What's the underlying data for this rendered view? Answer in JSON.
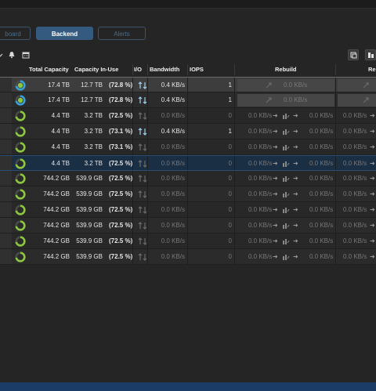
{
  "tabs": [
    {
      "label": "board"
    },
    {
      "label": "Backend"
    },
    {
      "label": "Alerts"
    }
  ],
  "columns": {
    "total_capacity": "Total Capacity",
    "capacity_in_use": "Capacity In-Use",
    "io": "I/O",
    "bandwidth": "Bandwidth",
    "iops": "IOPS",
    "rebuild": "Rebuild",
    "re": "Re"
  },
  "rows": [
    {
      "total": "17.4 TB",
      "inuse": "12.7 TB",
      "pct": "(72.8 %)",
      "bw": "0.4 KB/s",
      "iops": "1",
      "rb1": "0.0 KB/s",
      "rb2": "",
      "rb3": "",
      "active": true,
      "ring": "blue"
    },
    {
      "total": "17.4 TB",
      "inuse": "12.7 TB",
      "pct": "(72.8 %)",
      "bw": "0.4 KB/s",
      "iops": "1",
      "rb1": "0.0 KB/s",
      "rb2": "",
      "rb3": "",
      "active": true,
      "ring": "blue"
    },
    {
      "total": "4.4 TB",
      "inuse": "3.2 TB",
      "pct": "(72.5 %)",
      "bw": "0.0 KB/s",
      "iops": "0",
      "rb1": "0.0 KB/s",
      "rb2": "0.0 KB/s",
      "rb3": "0.0 KB/s",
      "active": false,
      "ring": "green"
    },
    {
      "total": "4.4 TB",
      "inuse": "3.2 TB",
      "pct": "(73.1 %)",
      "bw": "0.4 KB/s",
      "iops": "1",
      "rb1": "0.0 KB/s",
      "rb2": "0.0 KB/s",
      "rb3": "0.0 KB/s",
      "active": true,
      "ring": "green"
    },
    {
      "total": "4.4 TB",
      "inuse": "3.2 TB",
      "pct": "(73.1 %)",
      "bw": "0.0 KB/s",
      "iops": "0",
      "rb1": "0.0 KB/s",
      "rb2": "0.0 KB/s",
      "rb3": "0.0 KB/s",
      "active": false,
      "ring": "green"
    },
    {
      "total": "4.4 TB",
      "inuse": "3.2 TB",
      "pct": "(72.5 %)",
      "bw": "0.0 KB/s",
      "iops": "0",
      "rb1": "0.0 KB/s",
      "rb2": "0.0 KB/s",
      "rb3": "0.0 KB/s",
      "active": false,
      "ring": "green"
    },
    {
      "total": "744.2 GB",
      "inuse": "539.9 GB",
      "pct": "(72.5 %)",
      "bw": "0.0 KB/s",
      "iops": "0",
      "rb1": "0.0 KB/s",
      "rb2": "0.0 KB/s",
      "rb3": "0.0 KB/s",
      "active": false,
      "ring": "green"
    },
    {
      "total": "744.2 GB",
      "inuse": "539.9 GB",
      "pct": "(72.5 %)",
      "bw": "0.0 KB/s",
      "iops": "0",
      "rb1": "0.0 KB/s",
      "rb2": "0.0 KB/s",
      "rb3": "0.0 KB/s",
      "active": false,
      "ring": "green"
    },
    {
      "total": "744.2 GB",
      "inuse": "539.9 GB",
      "pct": "(72.5 %)",
      "bw": "0.0 KB/s",
      "iops": "0",
      "rb1": "0.0 KB/s",
      "rb2": "0.0 KB/s",
      "rb3": "0.0 KB/s",
      "active": false,
      "ring": "green"
    },
    {
      "total": "744.2 GB",
      "inuse": "539.9 GB",
      "pct": "(72.5 %)",
      "bw": "0.0 KB/s",
      "iops": "0",
      "rb1": "0.0 KB/s",
      "rb2": "0.0 KB/s",
      "rb3": "0.0 KB/s",
      "active": false,
      "ring": "green"
    },
    {
      "total": "744.2 GB",
      "inuse": "539.9 GB",
      "pct": "(72.5 %)",
      "bw": "0.0 KB/s",
      "iops": "0",
      "rb1": "0.0 KB/s",
      "rb2": "0.0 KB/s",
      "rb3": "0.0 KB/s",
      "active": false,
      "ring": "green"
    },
    {
      "total": "744.2 GB",
      "inuse": "539.9 GB",
      "pct": "(72.5 %)",
      "bw": "0.0 KB/s",
      "iops": "0",
      "rb1": "0.0 KB/s",
      "rb2": "0.0 KB/s",
      "rb3": "0.0 KB/s",
      "active": false,
      "ring": "green"
    }
  ],
  "colors": {
    "accent": "#355a80",
    "ring_green": "#8dc63f",
    "ring_blue": "#3aa0d8",
    "selected_row": "#1a2e44",
    "footer": "#1b3c66"
  },
  "icons": [
    "chevron-down-icon",
    "bell-icon",
    "calendar-icon",
    "copy-icon",
    "settings-icon",
    "io-arrows-icon",
    "rebuild-icon",
    "ring-icon"
  ]
}
